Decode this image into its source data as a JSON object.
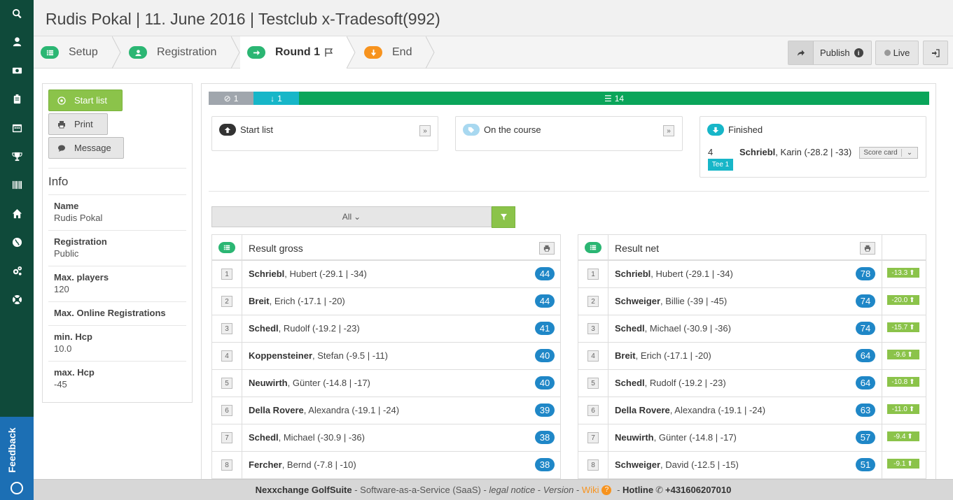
{
  "header": {
    "title": "Rudis Pokal | 11. June 2016 | Testclub x-Tradesoft(992)"
  },
  "steps": [
    {
      "label": "Setup"
    },
    {
      "label": "Registration"
    },
    {
      "label": "Round 1"
    },
    {
      "label": "End"
    }
  ],
  "topbar": {
    "publish_label": "Publish",
    "live_label": "Live"
  },
  "actions": {
    "start_list": "Start list",
    "print": "Print",
    "message": "Message"
  },
  "info": {
    "title": "Info",
    "items": [
      {
        "label": "Name",
        "value": "Rudis Pokal"
      },
      {
        "label": "Registration",
        "value": "Public"
      },
      {
        "label": "Max. players",
        "value": "120"
      },
      {
        "label": "Max. Online Registrations",
        "value": ""
      },
      {
        "label": "min. Hcp",
        "value": "10.0"
      },
      {
        "label": "max. Hcp",
        "value": "-45"
      }
    ]
  },
  "progress": {
    "excluded": "1",
    "on_course": "1",
    "finished": "14"
  },
  "status": {
    "start_list": "Start list",
    "on_course": "On the course",
    "finished": "Finished",
    "finished_entry": {
      "number": "4",
      "surname": "Schriebl",
      "rest": ", Karin (-28.2 | -33)",
      "tee": "Tee 1",
      "button": "Score card"
    }
  },
  "filter": {
    "label": "All"
  },
  "gross": {
    "title": "Result gross",
    "rows": [
      {
        "rank": "1",
        "surname": "Schriebl",
        "rest": ", Hubert (-29.1 | -34)",
        "score": "44"
      },
      {
        "rank": "2",
        "surname": "Breit",
        "rest": ", Erich (-17.1 | -20)",
        "score": "44"
      },
      {
        "rank": "3",
        "surname": "Schedl",
        "rest": ", Rudolf (-19.2 | -23)",
        "score": "41"
      },
      {
        "rank": "4",
        "surname": "Koppensteiner",
        "rest": ", Stefan (-9.5 | -11)",
        "score": "40"
      },
      {
        "rank": "5",
        "surname": "Neuwirth",
        "rest": ", Günter (-14.8 | -17)",
        "score": "40"
      },
      {
        "rank": "6",
        "surname": "Della Rovere",
        "rest": ", Alexandra (-19.1 | -24)",
        "score": "39"
      },
      {
        "rank": "7",
        "surname": "Schedl",
        "rest": ", Michael (-30.9 | -36)",
        "score": "38"
      },
      {
        "rank": "8",
        "surname": "Fercher",
        "rest": ", Bernd (-7.8 | -10)",
        "score": "38"
      }
    ]
  },
  "net": {
    "title": "Result net",
    "rows": [
      {
        "rank": "1",
        "surname": "Schriebl",
        "rest": ", Hubert (-29.1 | -34)",
        "score": "78",
        "delta": "-13.3"
      },
      {
        "rank": "2",
        "surname": "Schweiger",
        "rest": ", Billie (-39 | -45)",
        "score": "74",
        "delta": "-20.0"
      },
      {
        "rank": "3",
        "surname": "Schedl",
        "rest": ", Michael (-30.9 | -36)",
        "score": "74",
        "delta": "-15.7"
      },
      {
        "rank": "4",
        "surname": "Breit",
        "rest": ", Erich (-17.1 | -20)",
        "score": "64",
        "delta": "-9.6"
      },
      {
        "rank": "5",
        "surname": "Schedl",
        "rest": ", Rudolf (-19.2 | -23)",
        "score": "64",
        "delta": "-10.8"
      },
      {
        "rank": "6",
        "surname": "Della Rovere",
        "rest": ", Alexandra (-19.1 | -24)",
        "score": "63",
        "delta": "-11.0"
      },
      {
        "rank": "7",
        "surname": "Neuwirth",
        "rest": ", Günter (-14.8 | -17)",
        "score": "57",
        "delta": "-9.4"
      },
      {
        "rank": "8",
        "surname": "Schweiger",
        "rest": ", David (-12.5 | -15)",
        "score": "51",
        "delta": "-9.1"
      }
    ]
  },
  "footer": {
    "brand": "Nexxchange GolfSuite",
    "saas": " - Software-as-a-Service (SaaS) - ",
    "legal": "legal notice",
    "sep1": " - ",
    "version": "Version",
    "sep2": " - ",
    "wiki": "Wiki",
    "sep3": " - ",
    "hotline_label": "Hotline",
    "hotline_number": "+431606207010"
  },
  "sidebar": {
    "feedback": "Feedback"
  },
  "colors": {
    "sidebar": "#0f4a3a",
    "green": "#2bb673",
    "orange": "#f7931e",
    "blue": "#1f87c7",
    "teal": "#17b6c8",
    "lightgreen": "#8bc34a",
    "progress_green": "#0aa55a"
  },
  "icons": [
    "search-icon",
    "user-icon",
    "money-icon",
    "clipboard-icon",
    "calendar-icon",
    "trophy-icon",
    "barcode-icon",
    "home-icon",
    "globe-icon",
    "cogs-icon",
    "life-ring-icon",
    "share-icon",
    "info-icon",
    "sign-out-icon",
    "play-circle-icon",
    "print-icon",
    "comment-icon",
    "ban-icon",
    "arrow-down-icon",
    "list-icon",
    "arrow-up-icon",
    "tag-icon",
    "filter-icon",
    "phone-icon",
    "flag-icon"
  ]
}
